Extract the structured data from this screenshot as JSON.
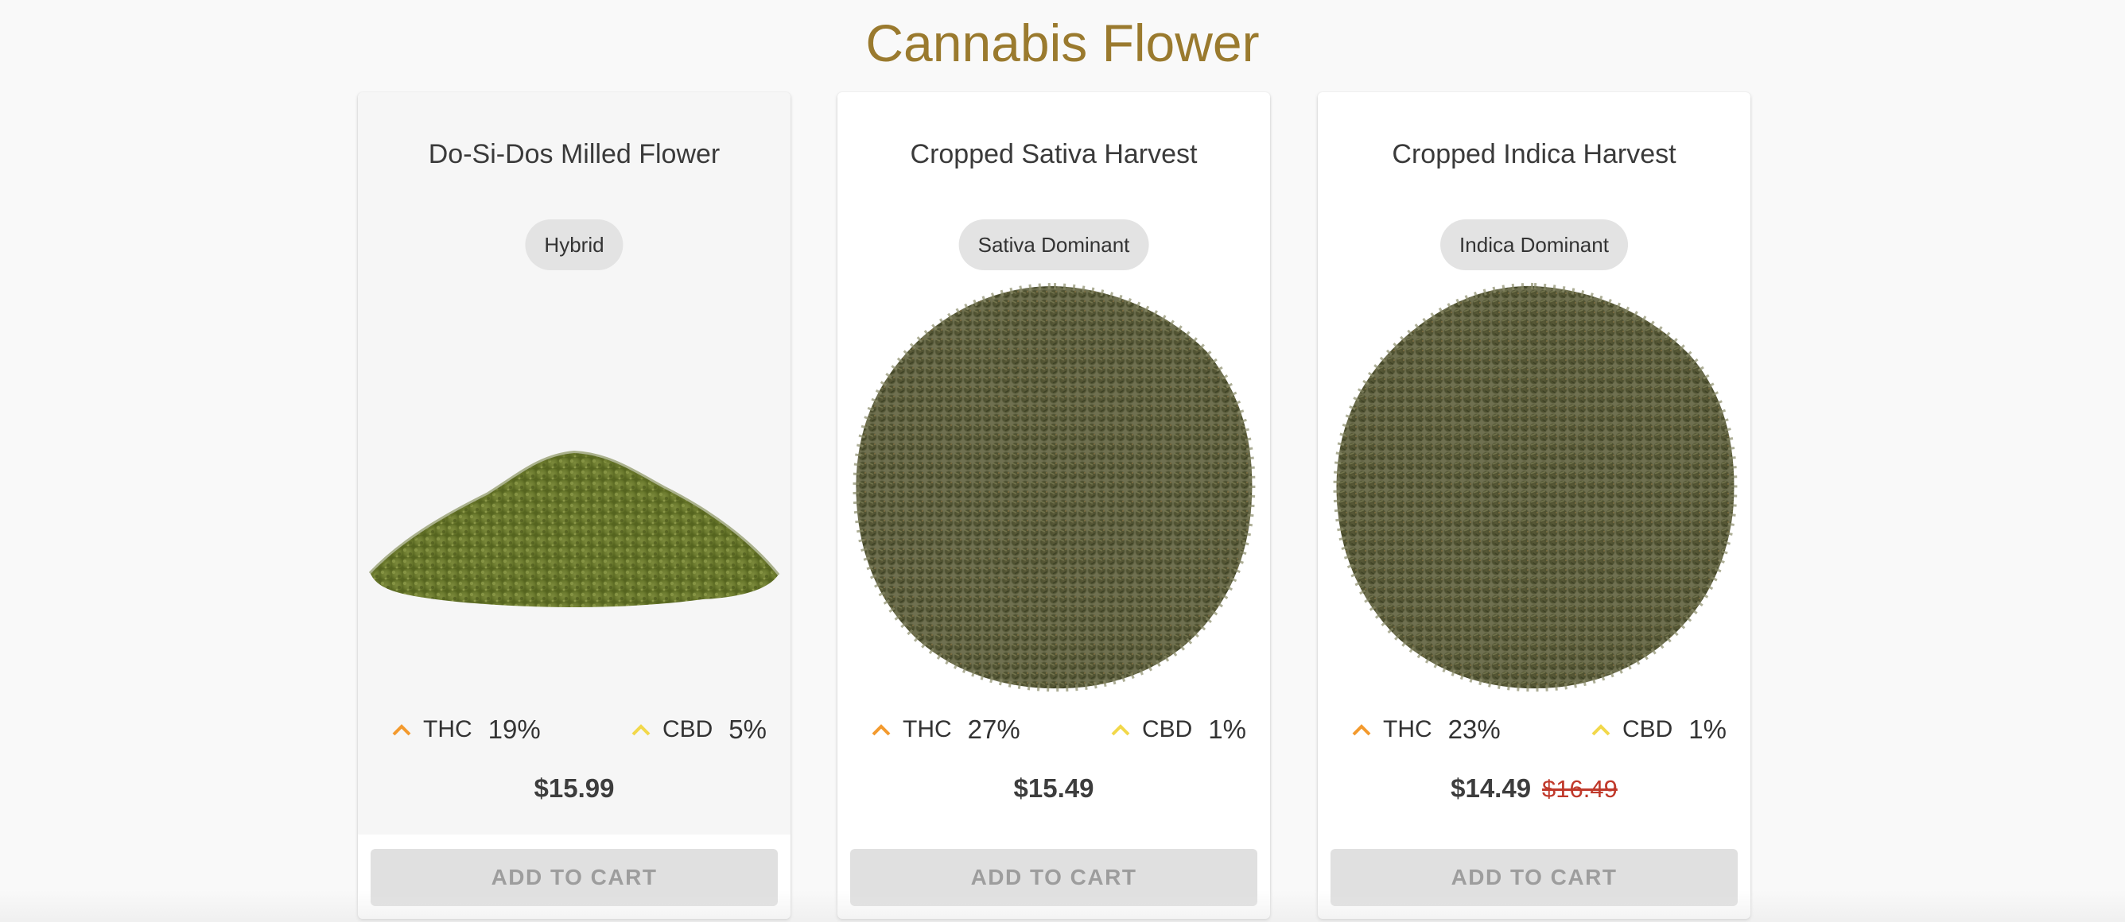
{
  "page": {
    "title": "Cannabis Flower",
    "title_color": "#9a7a2e"
  },
  "products": [
    {
      "name": "Do-Si-Dos Milled Flower",
      "type": "Hybrid",
      "image": "milled-flower-pile",
      "thc_label": "THC",
      "thc_value": "19%",
      "cbd_label": "CBD",
      "cbd_value": "5%",
      "price": "$15.99",
      "old_price": "",
      "button_label": "ADD TO CART"
    },
    {
      "name": "Cropped Sativa Harvest",
      "type": "Sativa Dominant",
      "image": "ground-flower-pile",
      "thc_label": "THC",
      "thc_value": "27%",
      "cbd_label": "CBD",
      "cbd_value": "1%",
      "price": "$15.49",
      "old_price": "",
      "button_label": "ADD TO CART"
    },
    {
      "name": "Cropped Indica Harvest",
      "type": "Indica Dominant",
      "image": "ground-flower-pile",
      "thc_label": "THC",
      "thc_value": "23%",
      "cbd_label": "CBD",
      "cbd_value": "1%",
      "price": "$14.49",
      "old_price": "$16.49",
      "button_label": "ADD TO CART"
    }
  ],
  "colors": {
    "thc_icon": "#f39a2e",
    "cbd_icon": "#f2d84a",
    "sale_price": "#c0392b",
    "button_bg": "#e0e0e0",
    "button_text": "#9d9d9d"
  }
}
